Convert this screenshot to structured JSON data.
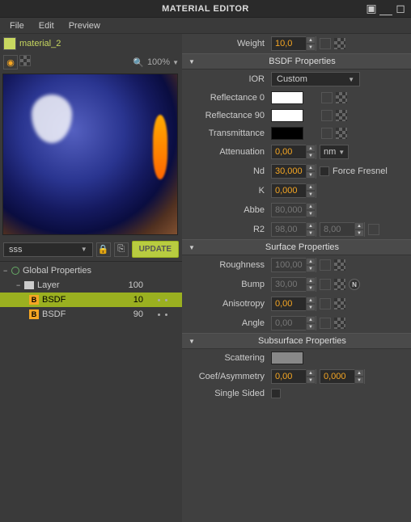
{
  "title": "MATERIAL EDITOR",
  "menu": {
    "file": "File",
    "edit": "Edit",
    "preview": "Preview"
  },
  "material": {
    "name": "material_2",
    "zoom": "100%"
  },
  "left": {
    "preset_dd": "sss",
    "update_btn": "UPDATE",
    "tree": {
      "global": "Global Properties",
      "layer": {
        "label": "Layer",
        "value": "100"
      },
      "bsdf1": {
        "label": "BSDF",
        "value": "10"
      },
      "bsdf2": {
        "label": "BSDF",
        "value": "90"
      }
    }
  },
  "weight": {
    "label": "Weight",
    "value": "10,0"
  },
  "sections": {
    "bsdf": "BSDF Properties",
    "surface": "Surface Properties",
    "subsurface": "Subsurface Properties"
  },
  "bsdf": {
    "ior_label": "IOR",
    "ior_value": "Custom",
    "reflectance0": "Reflectance 0",
    "reflectance90": "Reflectance 90",
    "transmittance": "Transmittance",
    "attenuation_label": "Attenuation",
    "attenuation_value": "0,00",
    "attenuation_unit": "nm",
    "nd_label": "Nd",
    "nd_value": "30,000",
    "force_fresnel": "Force Fresnel",
    "k_label": "K",
    "k_value": "0,000",
    "abbe_label": "Abbe",
    "abbe_value": "80,000",
    "r2_label": "R2",
    "r2_v1": "98,00",
    "r2_v2": "8,00"
  },
  "surface": {
    "roughness_label": "Roughness",
    "roughness_value": "100,00",
    "bump_label": "Bump",
    "bump_value": "30,00",
    "anisotropy_label": "Anisotropy",
    "anisotropy_value": "0,00",
    "angle_label": "Angle",
    "angle_value": "0,00"
  },
  "subsurface": {
    "scattering_label": "Scattering",
    "coef_label": "Coef/Asymmetry",
    "coef_v1": "0,00",
    "coef_v2": "0,000",
    "single_sided": "Single Sided"
  }
}
